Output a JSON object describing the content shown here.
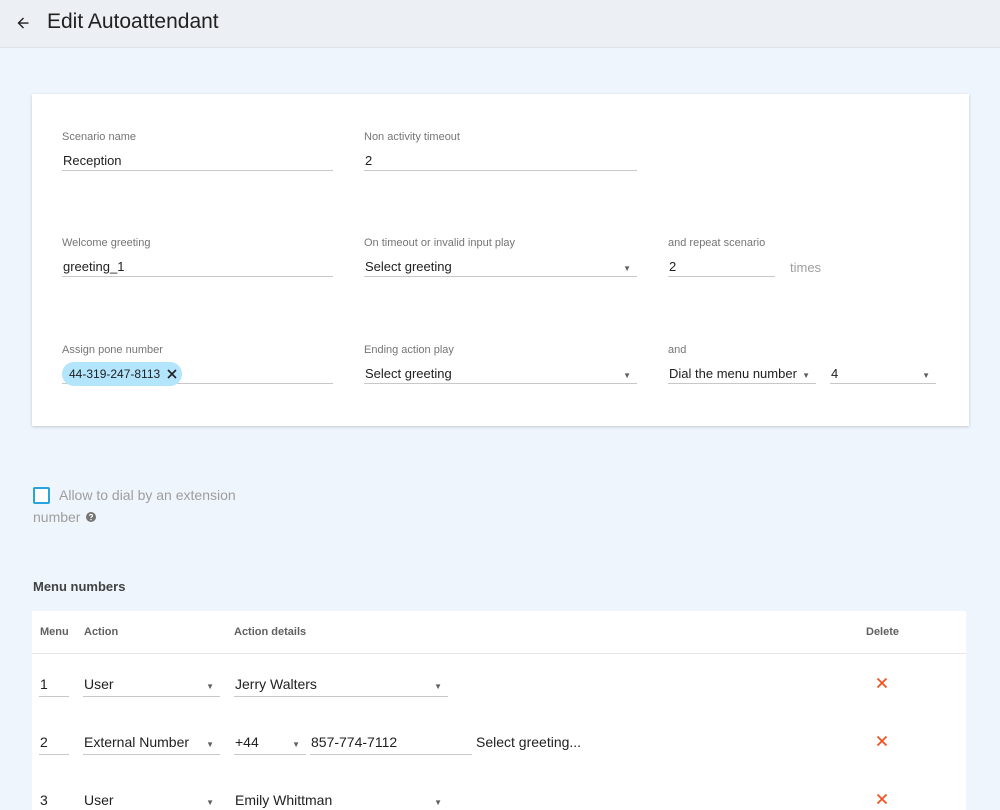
{
  "header": {
    "title": "Edit Autoattendant",
    "back_icon": "arrow-left-icon"
  },
  "form": {
    "scenario_name": {
      "label": "Scenario name",
      "value": "Reception"
    },
    "non_activity_timeout": {
      "label": "Non activity timeout",
      "value": "2"
    },
    "welcome_greeting": {
      "label": "Welcome greeting",
      "value": "greeting_1"
    },
    "timeout_play": {
      "label": "On timeout or invalid input play",
      "value": "Select greeting"
    },
    "repeat_scenario": {
      "label": "and repeat scenario",
      "value": "2",
      "suffix": "times"
    },
    "assign_phone": {
      "label": "Assign pone number",
      "chip": "44-319-247-8113"
    },
    "ending_action": {
      "label": "Ending action play",
      "value": "Select greeting"
    },
    "and_action": {
      "label": "and",
      "value": "Dial the menu number",
      "number": "4"
    }
  },
  "extension": {
    "label_line1": "Allow to dial by an extension",
    "label_line2": "number",
    "checked": false
  },
  "menu": {
    "title": "Menu numbers",
    "headers": {
      "menu": "Menu",
      "action": "Action",
      "details": "Action details",
      "delete": "Delete"
    },
    "rows": [
      {
        "menu": "1",
        "action": "User",
        "detail": "Jerry Walters"
      },
      {
        "menu": "2",
        "action": "External Number",
        "country": "+44",
        "number": "857-774-7112",
        "greeting": "Select greeting..."
      },
      {
        "menu": "3",
        "action": "User",
        "detail": "Emily Whittman"
      }
    ]
  },
  "colors": {
    "accent": "#29a3db",
    "chip": "#b3e5fc",
    "delete": "#f4511e",
    "background": "#eef5fc"
  }
}
